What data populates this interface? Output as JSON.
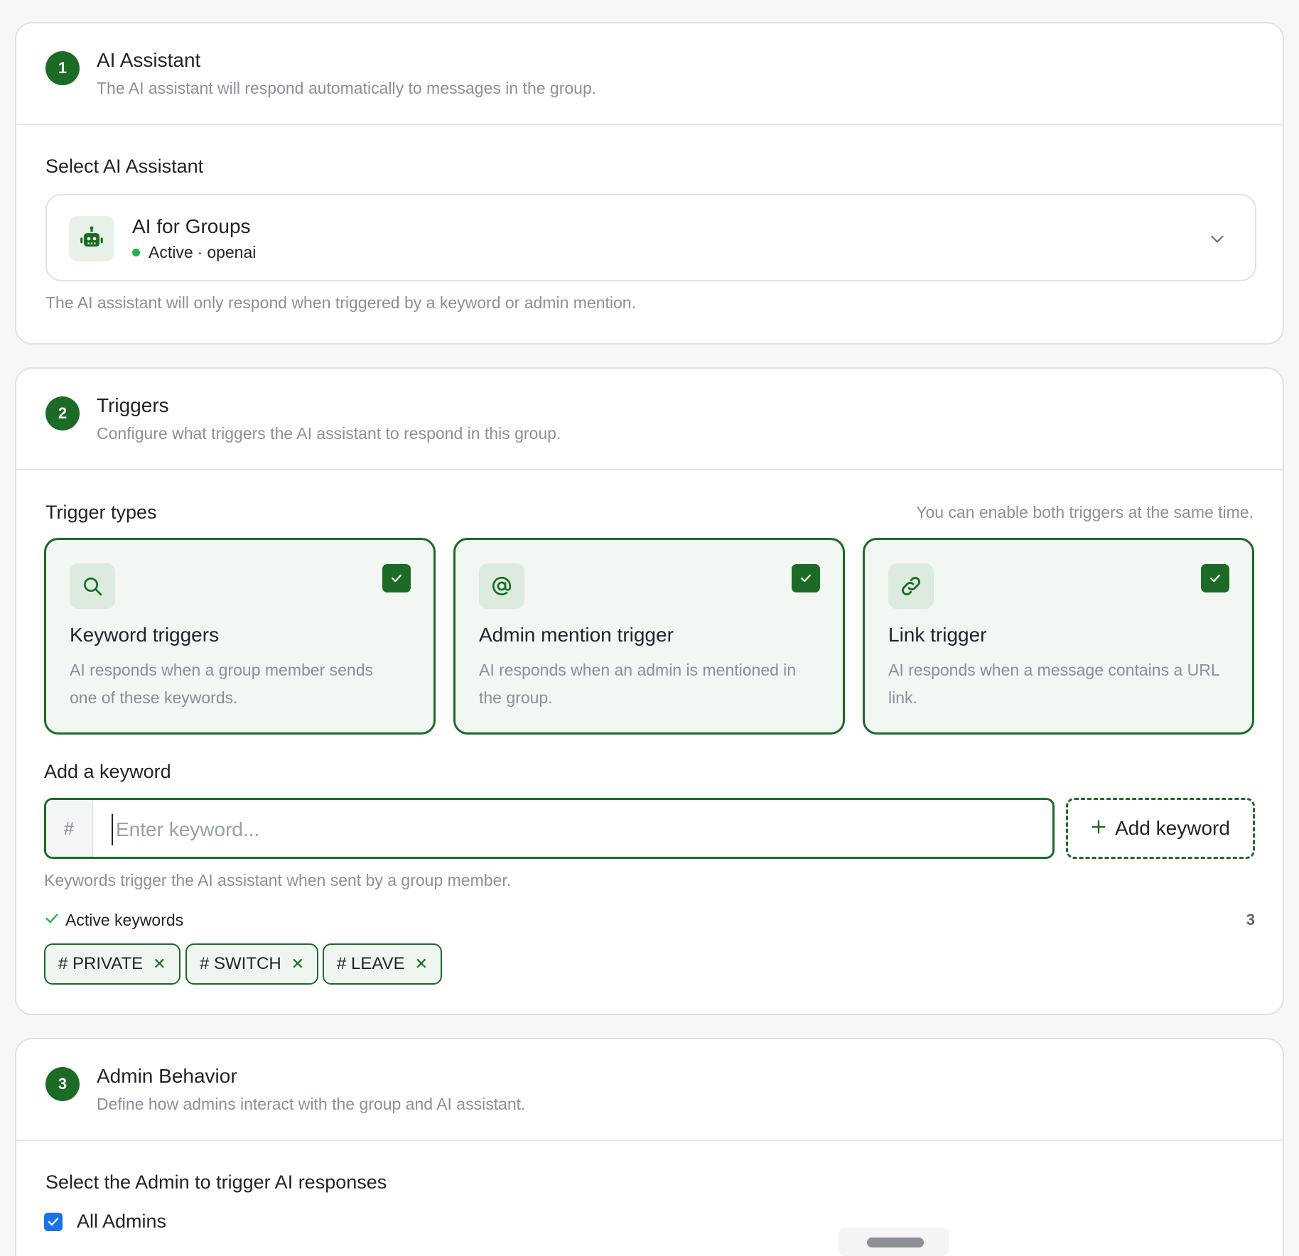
{
  "section1": {
    "step": "1",
    "title": "AI Assistant",
    "subtitle": "The AI assistant will respond automatically to messages in the group.",
    "select_label": "Select AI Assistant",
    "selected": {
      "name": "AI for Groups",
      "status": "Active",
      "separator": "·",
      "provider": "openai",
      "icon": "robot-icon"
    },
    "hint": "The AI assistant will only respond when triggered by a keyword or admin mention."
  },
  "section2": {
    "step": "2",
    "title": "Triggers",
    "subtitle": "Configure what triggers the AI assistant to respond in this group.",
    "types_label": "Trigger types",
    "types_hint": "You can enable both triggers at the same time.",
    "triggers": [
      {
        "title": "Keyword triggers",
        "desc": "AI responds when a group member sends one of these keywords.",
        "icon": "search-icon",
        "checked": true
      },
      {
        "title": "Admin mention trigger",
        "desc": "AI responds when an admin is mentioned in the group.",
        "icon": "at-icon",
        "checked": true
      },
      {
        "title": "Link trigger",
        "desc": "AI responds when a message contains a URL link.",
        "icon": "link-icon",
        "checked": true
      }
    ],
    "add_label": "Add a keyword",
    "input_prefix": "#",
    "input_placeholder": "Enter keyword...",
    "add_button": "Add keyword",
    "input_hint": "Keywords trigger the AI assistant when sent by a group member.",
    "active_label": "Active keywords",
    "active_count": "3",
    "keywords": [
      "# PRIVATE",
      "# SWITCH",
      "# LEAVE"
    ]
  },
  "section3": {
    "step": "3",
    "title": "Admin Behavior",
    "subtitle": "Define how admins interact with the group and AI assistant.",
    "select_label": "Select the Admin to trigger AI responses",
    "all_admins_label": "All Admins",
    "all_admins_checked": true
  },
  "colors": {
    "accent": "#1b6b26",
    "status_active": "#22b24c",
    "checkbox": "#1a73e8"
  }
}
